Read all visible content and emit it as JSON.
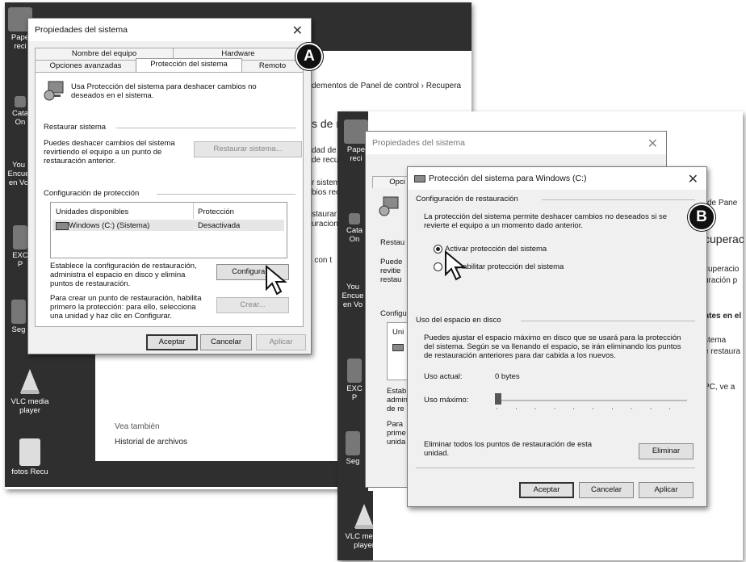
{
  "badges": {
    "a": "A",
    "b": "B"
  },
  "desktop": {
    "icons_left": [
      {
        "label": "Pape\nreci",
        "icon": "recycle-bin-icon"
      },
      {
        "label": "Cata\nOn",
        "icon": "shortcut-icon"
      },
      {
        "label": "You\nEncue\nen Vo",
        "icon": "youtube-icon"
      },
      {
        "label": "EXC\nP",
        "icon": "excel-icon"
      },
      {
        "label": "Seg",
        "icon": "app-icon"
      },
      {
        "label": "VLC media\nplayer",
        "icon": "vlc-icon"
      },
      {
        "label": "fotos Recu",
        "icon": "folder-icon"
      }
    ],
    "icons_right": [
      {
        "label": "Pape\nreci",
        "icon": "recycle-bin-icon"
      },
      {
        "label": "Cata\nOn",
        "icon": "shortcut-icon"
      },
      {
        "label": "You\nEncue\nen Vo",
        "icon": "youtube-icon"
      },
      {
        "label": "EXC\nP",
        "icon": "excel-icon"
      },
      {
        "label": "Seg",
        "icon": "app-icon"
      },
      {
        "label": "VLC media\nplayer",
        "icon": "vlc-icon"
      }
    ]
  },
  "shotA": {
    "bg": {
      "breadcrumb": "dementos de Panel de control  ›  Recupera",
      "heading": "s de re",
      "lines": [
        "dad de r",
        "de recu",
        "r sistem",
        "bios reci",
        "staurar s",
        "uracion"
      ],
      "extra": "as con t",
      "see_also": "Vea también",
      "history": "Historial de archivos"
    },
    "dialog": {
      "title": "Propiedades del sistema",
      "tabs_top": [
        "Nombre del equipo",
        "Hardware"
      ],
      "tabs_bottom": [
        "Opciones avanzadas",
        "Protección del sistema",
        "Remoto"
      ],
      "intro": "Usa Protección del sistema para deshacer cambios no deseados en el sistema.",
      "restore_group": "Restaurar sistema",
      "restore_text": "Puedes deshacer cambios del sistema revirtiendo el equipo a un punto de restauración anterior.",
      "restore_button": "Restaurar sistema...",
      "config_group": "Configuración de protección",
      "col_drives": "Unidades disponibles",
      "col_protection": "Protección",
      "drive_name": "Windows (C:) (Sistema)",
      "drive_status": "Desactivada",
      "config_text": "Establece la configuración de restauración, administra el espacio en disco y elimina puntos de restauración.",
      "config_button": "Configurar...",
      "create_text": "Para crear un punto de restauración, habilita primero la protección: para ello, selecciona una unidad y haz clic en Configurar.",
      "create_button": "Crear...",
      "ok": "Aceptar",
      "cancel": "Cancelar",
      "apply": "Aplicar"
    }
  },
  "shotB": {
    "bg": {
      "right_lines": [
        "de Pane",
        "cuperac",
        "cuperacio",
        "uración p",
        "ntes en el",
        "stema",
        "e restaura",
        "PC, ve a"
      ],
      "parent_title": "Propiedades del sistema",
      "parent_tab": "Opci",
      "parent_left": [
        "Restau",
        "Puede",
        "revitie",
        "restau",
        "Configu",
        "Uni",
        "Estab",
        "admin",
        "de re",
        "Para",
        "prime",
        "unida"
      ]
    },
    "dialog": {
      "title": "Protección del sistema para Windows (C:)",
      "restore_group": "Configuración de restauración",
      "restore_text": "La protección del sistema permite deshacer cambios no deseados si se revierte el equipo a un momento dado anterior.",
      "radio_on": "Activar protección del sistema",
      "radio_off": "Deshabilitar protección del sistema",
      "disk_group": "Uso del espacio en disco",
      "disk_text": "Puedes ajustar el espacio máximo en disco que se usará para la protección del sistema. Según se va llenando el espacio, se irán eliminando los puntos de restauración anteriores para dar cabida a los nuevos.",
      "current_label": "Uso actual:",
      "current_value": "0 bytes",
      "max_label": "Uso máximo:",
      "max_value_fraction": 0.0,
      "delete_text": "Eliminar todos los puntos de restauración de esta unidad.",
      "delete_button": "Eliminar",
      "ok": "Aceptar",
      "cancel": "Cancelar",
      "apply": "Aplicar"
    }
  }
}
